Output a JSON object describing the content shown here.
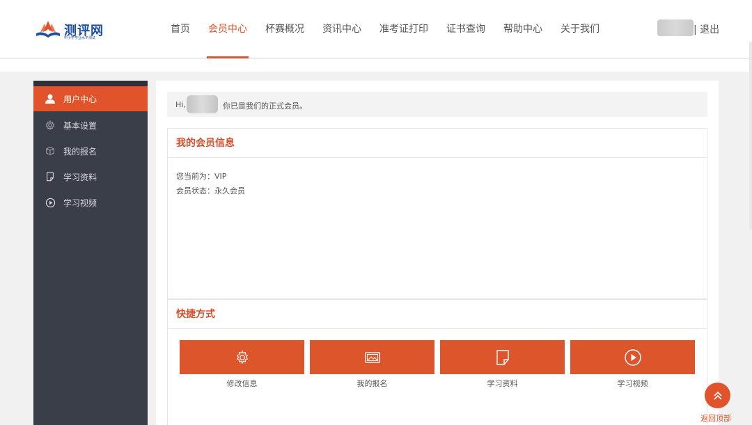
{
  "header": {
    "logo_name": "测评网",
    "logo_sub": "中小学学业水平测试",
    "nav": [
      "首页",
      "会员中心",
      "杯赛概况",
      "资讯中心",
      "准考证打印",
      "证书查询",
      "帮助中心",
      "关于我们"
    ],
    "active_nav": "会员中心",
    "logout": "| 退出"
  },
  "sidebar": {
    "items": [
      {
        "label": "用户中心",
        "icon": "user-icon",
        "active": true
      },
      {
        "label": "基本设置",
        "icon": "gear-icon",
        "active": false
      },
      {
        "label": "我的报名",
        "icon": "box-icon",
        "active": false
      },
      {
        "label": "学习资料",
        "icon": "document-icon",
        "active": false
      },
      {
        "label": "学习视频",
        "icon": "play-icon",
        "active": false
      }
    ]
  },
  "greeting": {
    "hi": "Hi,",
    "message": "你已是我们的正式会员。"
  },
  "member_info": {
    "title": "我的会员信息",
    "current_level": "您当前为：VIP",
    "status": "会员状态：永久会员"
  },
  "shortcuts": {
    "title": "快捷方式",
    "items": [
      {
        "label": "修改信息",
        "icon": "gear-icon"
      },
      {
        "label": "我的报名",
        "icon": "image-icon"
      },
      {
        "label": "学习资料",
        "icon": "document-icon"
      },
      {
        "label": "学习视频",
        "icon": "play-icon"
      }
    ]
  },
  "back_to_top": "返回顶部",
  "colors": {
    "accent": "#e0532b",
    "sidebar": "#3a3e48",
    "brand": "#1f4fa0"
  }
}
